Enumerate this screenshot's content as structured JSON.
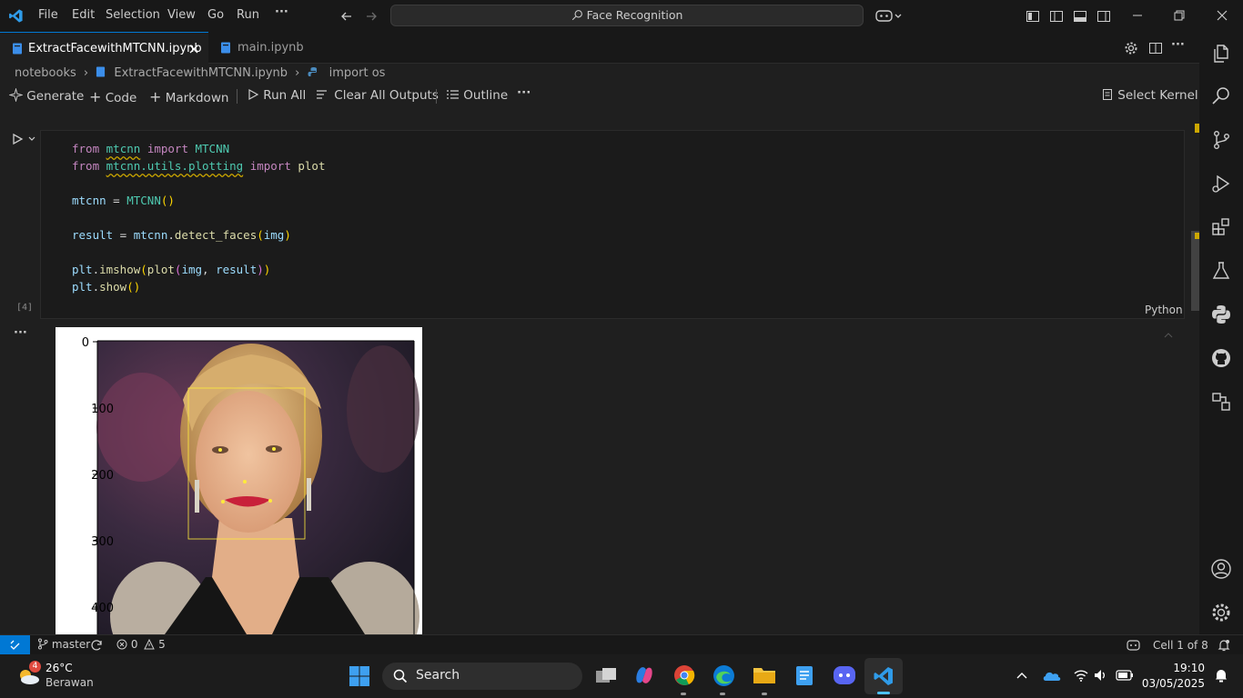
{
  "menu": [
    "File",
    "Edit",
    "Selection",
    "View",
    "Go",
    "Run"
  ],
  "menu_more": "···",
  "search_title": "Face Recognition",
  "tabs": [
    {
      "label": "ExtractFacewithMTCNN.ipynb",
      "active": true
    },
    {
      "label": "main.ipynb",
      "active": false
    }
  ],
  "breadcrumb": {
    "folder": "notebooks",
    "file": "ExtractFacewithMTCNN.ipynb",
    "symbol": "import os"
  },
  "toolbar": {
    "generate": "Generate",
    "code": "Code",
    "markdown": "Markdown",
    "run_all": "Run All",
    "clear_outputs": "Clear All Outputs",
    "outline": "Outline",
    "more": "···",
    "select_kernel": "Select Kernel"
  },
  "cell": {
    "exec_count": "[4]",
    "language": "Python",
    "lines": {
      "l1a": "from",
      "l1b": "mtcnn",
      "l1c": "import",
      "l1d": "MTCNN",
      "l2a": "from",
      "l2b": "mtcnn.utils.plotting",
      "l2c": "import",
      "l2d": "plot",
      "l3a": "mtcnn",
      "l3b": " = ",
      "l3c": "MTCNN",
      "l3d": "()",
      "l4a": "result",
      "l4b": " = ",
      "l4c": "mtcnn",
      "l4d": ".",
      "l4e": "detect_faces",
      "l4f": "(",
      "l4g": "img",
      "l4h": ")",
      "l5a": "plt",
      "l5b": ".",
      "l5c": "imshow",
      "l5d": "(",
      "l5e": "plot",
      "l5f": "(",
      "l5g": "img",
      "l5h": ", ",
      "l5i": "result",
      "l5j": ")",
      "l5k": ")",
      "l6a": "plt",
      "l6b": ".",
      "l6c": "show",
      "l6d": "()"
    }
  },
  "output": {
    "more": "···",
    "yticks": [
      "0",
      "100",
      "200",
      "300",
      "400"
    ]
  },
  "status": {
    "branch": "master",
    "errors": "0",
    "warnings": "5",
    "cell_position": "Cell 1 of 8"
  },
  "taskbar": {
    "weather_temp": "26°C",
    "weather_desc": "Berawan",
    "weather_badge": "4",
    "search": "Search",
    "time": "19:10",
    "date": "03/05/2025"
  },
  "colors": {
    "accent": "#0078d4",
    "bbox": "#ffeb3b",
    "background": "#1f1f1f"
  }
}
